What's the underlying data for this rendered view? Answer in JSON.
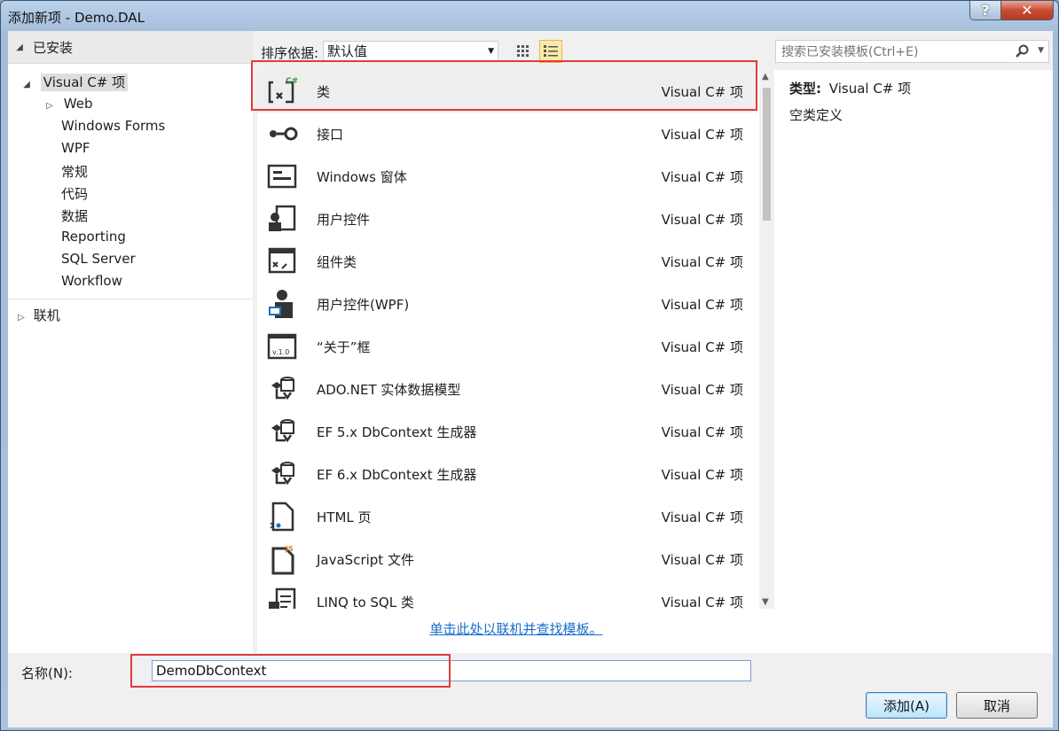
{
  "window": {
    "title": "添加新项 - Demo.DAL",
    "help_glyph": "?",
    "close_glyph": "✕"
  },
  "left_pane": {
    "installed_label": "已安装",
    "selected_node": "Visual C# 项",
    "children": [
      "Web",
      "Windows Forms",
      "WPF",
      "常规",
      "代码",
      "数据",
      "Reporting",
      "SQL Server",
      "Workflow"
    ],
    "online_label": "联机"
  },
  "toolbar": {
    "sort_label": "排序依据:",
    "sort_value": "默认值"
  },
  "templates": [
    {
      "name": "类",
      "type": "Visual C# 项",
      "icon": "class-icon"
    },
    {
      "name": "接口",
      "type": "Visual C# 项",
      "icon": "interface-icon"
    },
    {
      "name": "Windows 窗体",
      "type": "Visual C# 项",
      "icon": "windows-form-icon"
    },
    {
      "name": "用户控件",
      "type": "Visual C# 项",
      "icon": "user-control-icon"
    },
    {
      "name": "组件类",
      "type": "Visual C# 项",
      "icon": "component-class-icon"
    },
    {
      "name": "用户控件(WPF)",
      "type": "Visual C# 项",
      "icon": "wpf-user-control-icon"
    },
    {
      "name": "“关于”框",
      "type": "Visual C# 项",
      "icon": "about-box-icon"
    },
    {
      "name": "ADO.NET 实体数据模型",
      "type": "Visual C# 项",
      "icon": "data-model-icon"
    },
    {
      "name": "EF 5.x DbContext 生成器",
      "type": "Visual C# 项",
      "icon": "data-model-icon"
    },
    {
      "name": "EF 6.x DbContext 生成器",
      "type": "Visual C# 项",
      "icon": "data-model-icon"
    },
    {
      "name": "HTML 页",
      "type": "Visual C# 项",
      "icon": "html-page-icon"
    },
    {
      "name": "JavaScript 文件",
      "type": "Visual C# 项",
      "icon": "javascript-file-icon"
    },
    {
      "name": "LINQ to SQL 类",
      "type": "Visual C# 项",
      "icon": "linq-sql-icon"
    }
  ],
  "online_link": "单击此处以联机并查找模板。",
  "search": {
    "placeholder": "搜索已安装模板(Ctrl+E)"
  },
  "details": {
    "type_label": "类型:",
    "type_value": "Visual C# 项",
    "description": "空类定义"
  },
  "bottom": {
    "name_label": "名称(N):",
    "name_value": "DemoDbContext",
    "add_label": "添加(A)",
    "cancel_label": "取消"
  },
  "colors": {
    "highlight_box": "#e03c3c",
    "link": "#1a6fc9",
    "window_frame": "#a9c2de"
  }
}
